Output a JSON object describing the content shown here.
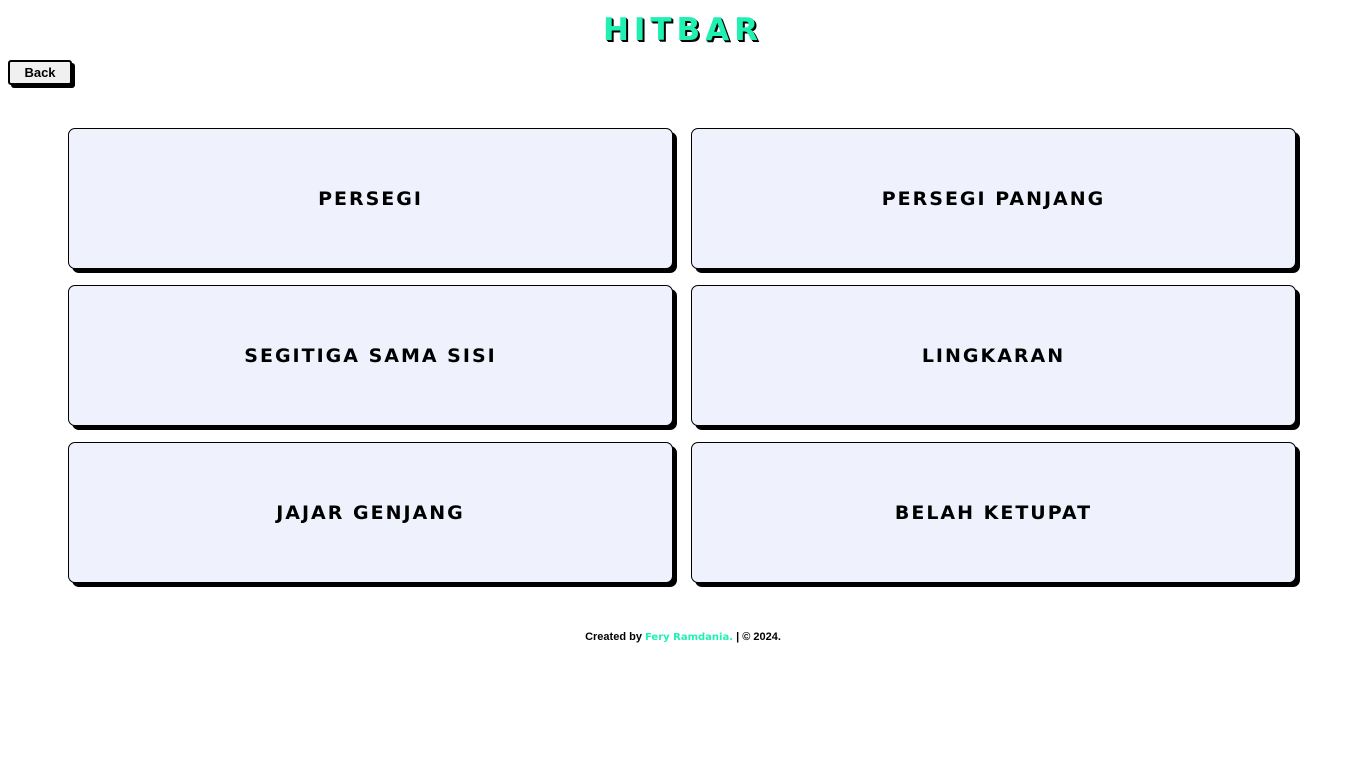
{
  "header": {
    "logo_text": "HITBAR",
    "back_label": "Back"
  },
  "shapes": [
    {
      "label": "PERSEGI"
    },
    {
      "label": "PERSEGI PANJANG"
    },
    {
      "label": "SEGITIGA SAMA SISI"
    },
    {
      "label": "LINGKARAN"
    },
    {
      "label": "JAJAR GENJANG"
    },
    {
      "label": "BELAH KETUPAT"
    }
  ],
  "footer": {
    "prefix": "Created by",
    "author": "Fery Ramdania.",
    "suffix": "| © 2024."
  },
  "colors": {
    "accent": "#20f0b2",
    "card_background": "#eff2fd",
    "border": "#000000"
  }
}
